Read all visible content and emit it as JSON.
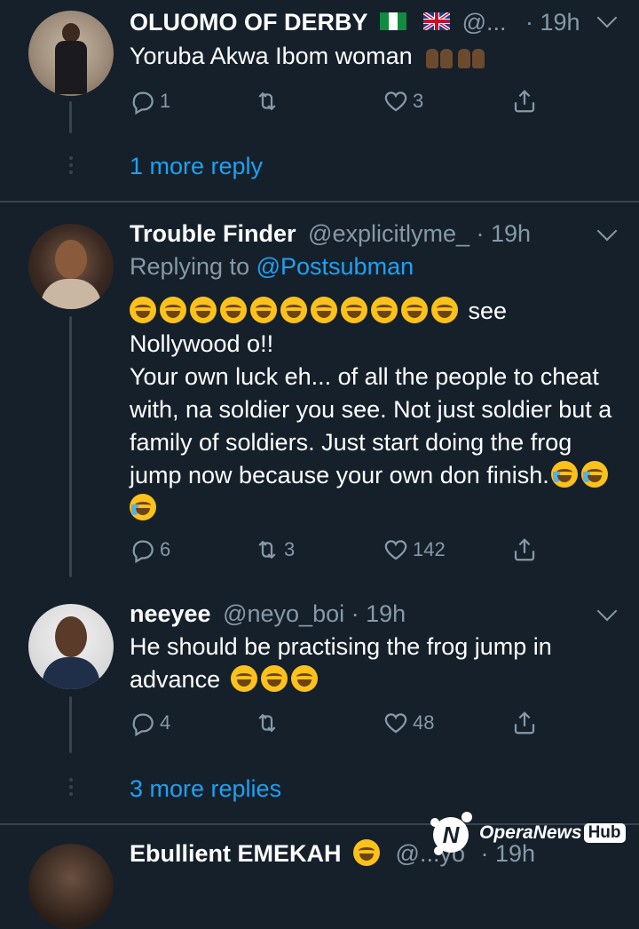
{
  "tweets": [
    {
      "name": "OLUOMO OF DERBY",
      "handle": "@...",
      "time": "· 19h",
      "text": "Yoruba Akwa Ibom woman",
      "replies": "1",
      "retweets": "",
      "likes": "3",
      "more_replies": "1 more reply"
    },
    {
      "name": "Trouble Finder",
      "handle": "@explicitlyme_",
      "time": "· 19h",
      "replying_prefix": "Replying to",
      "replying_to": "@Postsubman",
      "text_first": "see",
      "text_rest": "Nollywood o!!\nYour own luck eh... of all the people to cheat with, na soldier you see. Not just soldier but a family of soldiers. Just start doing the frog jump now because your own don finish.",
      "replies": "6",
      "retweets": "3",
      "likes": "142"
    },
    {
      "name": "neeyee",
      "handle": "@neyo_boi",
      "time": "· 19h",
      "text": "He should be practising the frog jump in advance",
      "replies": "4",
      "retweets": "",
      "likes": "48",
      "more_replies": "3 more replies"
    },
    {
      "name": "Ebullient EMEKAH",
      "handle": "@...yo",
      "time": "· 19h"
    }
  ],
  "watermark": {
    "brand": "OperaNews",
    "badge": "Hub"
  },
  "colors": {
    "background": "#15202b",
    "link": "#1da1f2",
    "muted": "#8899a6",
    "divider": "#38444d"
  }
}
